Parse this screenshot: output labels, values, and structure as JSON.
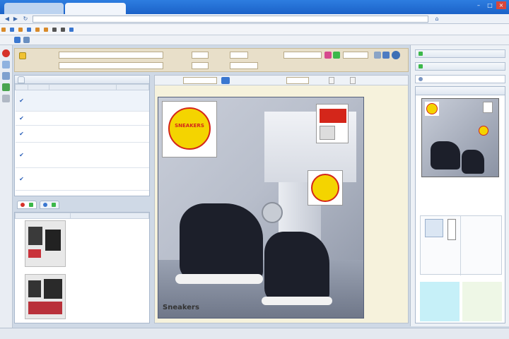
{
  "browser": {
    "tabs": [
      "",
      ""
    ],
    "url": "",
    "bookmarks": [
      "",
      "",
      "",
      "",
      "",
      "",
      "",
      "",
      ""
    ],
    "menu": [
      "",
      "",
      "",
      ""
    ]
  },
  "form": {
    "labels": [
      "",
      "",
      "",
      "",
      "",
      "",
      ""
    ],
    "values": [
      "",
      "",
      "",
      "",
      "",
      "",
      ""
    ]
  },
  "left_table": {
    "title": "",
    "columns": [
      "",
      "",
      "",
      ""
    ],
    "rows": [
      {
        "num": "",
        "desc": "",
        "status": ""
      },
      {
        "num": "",
        "desc": "",
        "status": ""
      },
      {
        "num": "",
        "desc": "",
        "status": ""
      },
      {
        "num": "",
        "desc": "",
        "status": ""
      },
      {
        "num": "",
        "desc": "",
        "status": ""
      }
    ]
  },
  "lower_panel": {
    "tabs": [
      "",
      ""
    ],
    "columns": [
      "",
      ""
    ],
    "rows": [
      {
        "caption": "",
        "value": ""
      },
      {
        "caption": "",
        "value": ""
      }
    ]
  },
  "canvas": {
    "toolbar": [
      "",
      "",
      "",
      "",
      "",
      ""
    ],
    "photo_caption": "Sneakers",
    "sticker_text": "SNEAKERS"
  },
  "right_panel": {
    "sections": [
      "",
      "",
      ""
    ],
    "preview_title": "",
    "thumb_caption": "",
    "bottom_caption": ""
  },
  "status": {
    "text": ""
  },
  "colors": {
    "titlebar": "#1b62c8",
    "formbar": "#e8dfc9",
    "canvas_bg": "#f6f2dc",
    "sticker_yellow": "#f4d400",
    "sticker_red": "#d4261a",
    "thumb_cyan": "#c6f0f8"
  },
  "icons": [
    "back-icon",
    "forward-icon",
    "reload-icon",
    "home-icon",
    "close-icon",
    "minimize-icon",
    "maximize-icon",
    "check-icon",
    "save-icon",
    "help-icon"
  ]
}
